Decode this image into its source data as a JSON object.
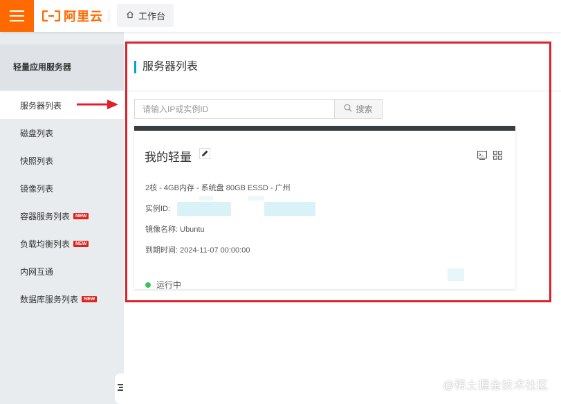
{
  "topbar": {
    "logo_text": "阿里云",
    "workbench_label": "工作台"
  },
  "sidebar": {
    "title": "轻量应用服务器",
    "items": [
      {
        "label": "服务器列表",
        "active": true,
        "badge": ""
      },
      {
        "label": "磁盘列表",
        "active": false,
        "badge": ""
      },
      {
        "label": "快照列表",
        "active": false,
        "badge": ""
      },
      {
        "label": "镜像列表",
        "active": false,
        "badge": ""
      },
      {
        "label": "容器服务列表",
        "active": false,
        "badge": "NEW"
      },
      {
        "label": "负载均衡列表",
        "active": false,
        "badge": "NEW"
      },
      {
        "label": "内网互通",
        "active": false,
        "badge": ""
      },
      {
        "label": "数据库服务列表",
        "active": false,
        "badge": "NEW"
      }
    ]
  },
  "main": {
    "page_title": "服务器列表",
    "search": {
      "placeholder": "请输入IP或实例ID",
      "value": "",
      "button_label": "搜索"
    },
    "server_card": {
      "name": "我的轻量",
      "spec": "2核 - 4GB内存 - 系统盘 80GB ESSD - 广州",
      "instance_id_label": "实例ID:",
      "image_name_label": "镜像名称:",
      "image_name": "Ubuntu",
      "expire_label": "到期时间:",
      "expire_time": "2024-11-07 00:00:00",
      "status": "运行中"
    }
  },
  "watermark": "@稀土掘金技术社区",
  "colors": {
    "brand_orange": "#ff6a00",
    "accent_blue": "#00a1d6",
    "running_green": "#3bc25f",
    "annotation_red": "#e0202a",
    "badge_red": "#e0221c",
    "card_header": "#373d41"
  },
  "icons": {
    "menu": "hamburger-icon",
    "home": "home-icon",
    "search": "search-icon",
    "edit": "pencil-icon",
    "terminal": "terminal-icon",
    "grid": "grid-icon",
    "collapse": "sidebar-collapse-icon"
  }
}
